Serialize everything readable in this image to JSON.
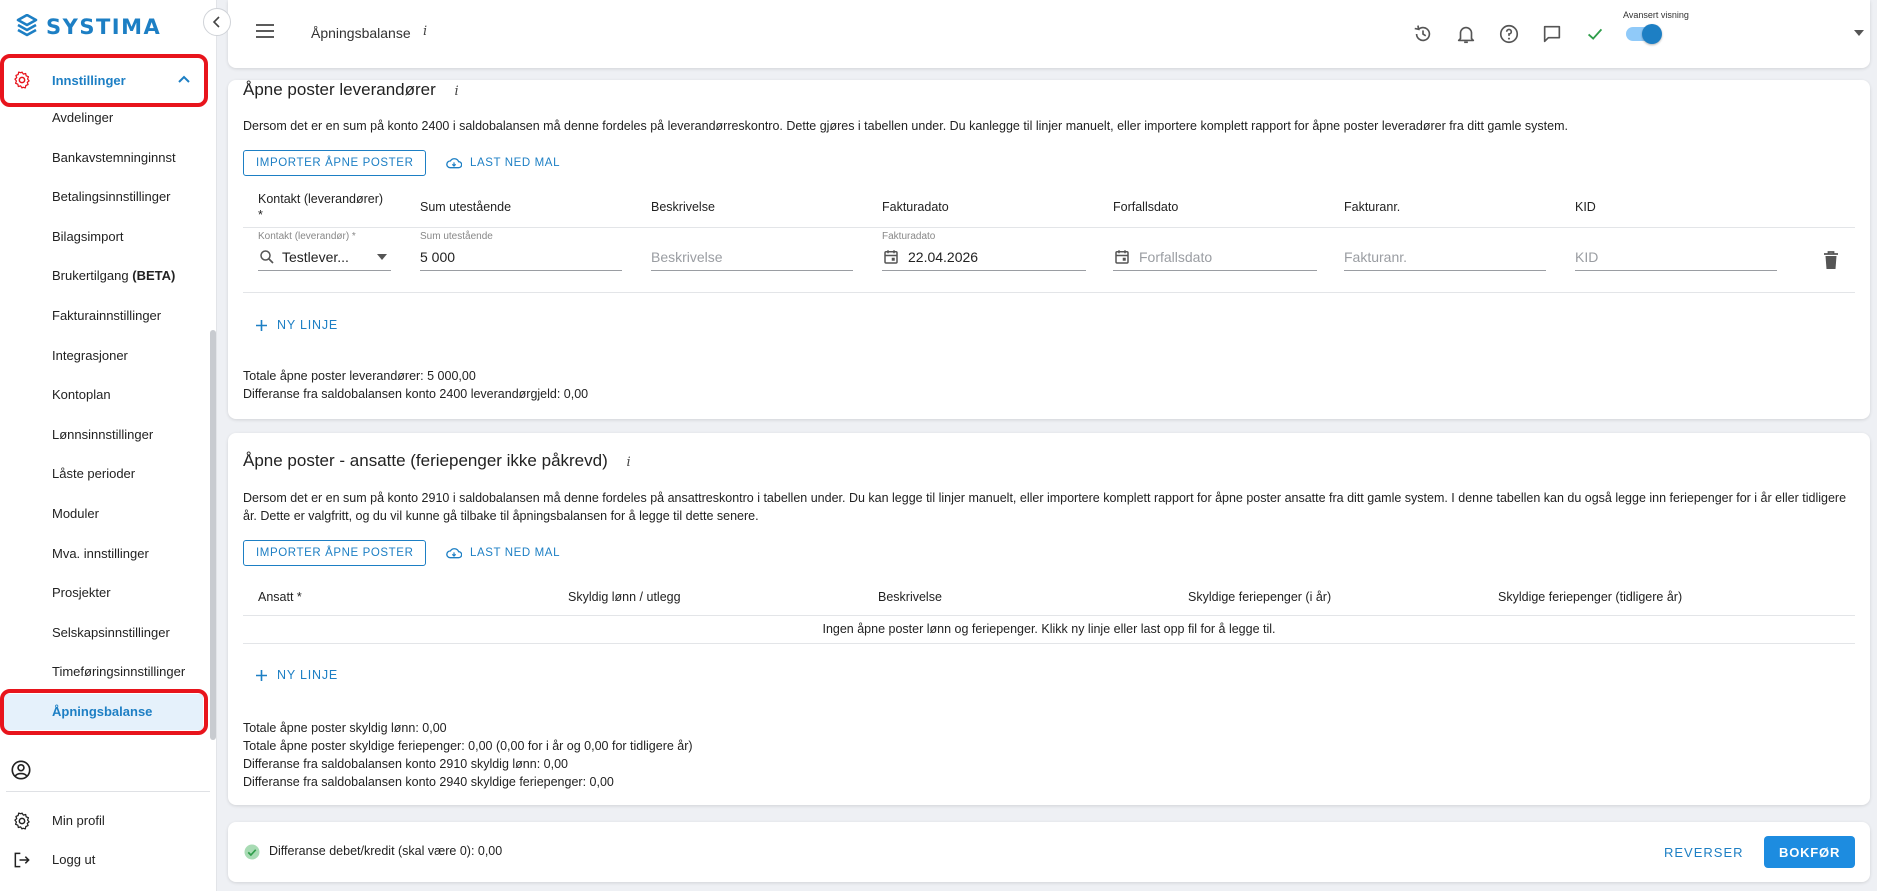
{
  "brand": {
    "name": "SYSTIMA",
    "color": "#1d7fc4"
  },
  "colors": {
    "accent": "#1d7fc4",
    "highlight_outline": "#e8141c",
    "success": "#2e9d4a"
  },
  "sidebar": {
    "parent": {
      "label": "Innstillinger",
      "icon": "gear-icon",
      "expanded": true
    },
    "items": [
      {
        "label": "Avdelinger"
      },
      {
        "label": "Bankavstemninginnst"
      },
      {
        "label": "Betalingsinnstillinger"
      },
      {
        "label": "Bilagsimport"
      },
      {
        "label": "Brukertilgang",
        "suffix": "(BETA)"
      },
      {
        "label": "Fakturainnstillinger"
      },
      {
        "label": "Integrasjoner"
      },
      {
        "label": "Kontoplan"
      },
      {
        "label": "Lønnsinnstillinger"
      },
      {
        "label": "Låste perioder"
      },
      {
        "label": "Moduler"
      },
      {
        "label": "Mva. innstillinger"
      },
      {
        "label": "Prosjekter"
      },
      {
        "label": "Selskapsinnstillinger"
      },
      {
        "label": "Timeføringsinnstillinger"
      },
      {
        "label": "Åpningsbalanse",
        "active": true
      }
    ],
    "bottom": {
      "profile_label": "Min profil",
      "logout_label": "Logg ut"
    }
  },
  "header": {
    "title": "Åpningsbalanse",
    "info": "i",
    "advanced_view_label": "Avansert visning",
    "advanced_view_on": true
  },
  "suppliers": {
    "title": "Åpne poster leverandører",
    "info": "i",
    "description": "Dersom det er en sum på konto 2400 i saldobalansen må denne fordeles på leverandørreskontro. Dette gjøres i tabellen under. Du kanlegge til linjer manuelt, eller importere komplett rapport for åpne poster leveradører fra ditt gamle system.",
    "import_label": "IMPORTER ÅPNE POSTER",
    "download_label": "LAST NED MAL",
    "columns": [
      "Kontakt (leverandører)",
      "Sum utestående",
      "Beskrivelse",
      "Fakturadato",
      "Forfallsdato",
      "Fakturanr.",
      "KID"
    ],
    "required_mark": "*",
    "row": {
      "contact_label": "Kontakt (leverandør) *",
      "contact_value": "Testlever...",
      "sum_label": "Sum utestående",
      "sum_value": "5 000",
      "description_placeholder": "Beskrivelse",
      "invoice_date_label": "Fakturadato",
      "invoice_date_value": "22.04.2026",
      "due_date_placeholder": "Forfallsdato",
      "invoice_no_placeholder": "Fakturanr.",
      "kid_placeholder": "KID"
    },
    "add_line_label": "NY LINJE",
    "total_line": "Totale åpne poster leverandører: 5 000,00",
    "diff_line": "Differanse fra saldobalansen konto 2400 leverandørgjeld: 0,00"
  },
  "employees": {
    "title": "Åpne poster - ansatte (feriepenger ikke påkrevd)",
    "info": "i",
    "description": "Dersom det er en sum på konto 2910 i saldobalansen må denne fordeles på ansattreskontro i tabellen under. Du kan legge til linjer manuelt, eller importere komplett rapport for åpne poster ansatte fra ditt gamle system. I denne tabellen kan du også legge inn feriepenger for i år eller tidligere år. Dette er valgfritt, og du vil kunne gå tilbake til åpningsbalansen for å legge til dette senere.",
    "import_label": "IMPORTER ÅPNE POSTER",
    "download_label": "LAST NED MAL",
    "columns": [
      "Ansatt *",
      "Skyldig lønn / utlegg",
      "Beskrivelse",
      "Skyldige feriepenger (i år)",
      "Skyldige feriepenger (tidligere år)"
    ],
    "empty_message": "Ingen åpne poster lønn og feriepenger. Klikk ny linje eller last opp fil for å legge til.",
    "add_line_label": "NY LINJE",
    "totals": [
      "Totale åpne poster skyldig lønn: 0,00",
      "Totale åpne poster skyldige feriepenger: 0,00 (0,00 for i år og 0,00 for tidligere år)",
      "Differanse fra saldobalansen konto 2910 skyldig lønn: 0,00",
      "Differanse fra saldobalansen konto 2940 skyldige feriepenger: 0,00"
    ]
  },
  "footer": {
    "status_text": "Differanse debet/kredit (skal være 0): 0,00",
    "reverse_label": "REVERSER",
    "post_label": "BOKFØR"
  }
}
